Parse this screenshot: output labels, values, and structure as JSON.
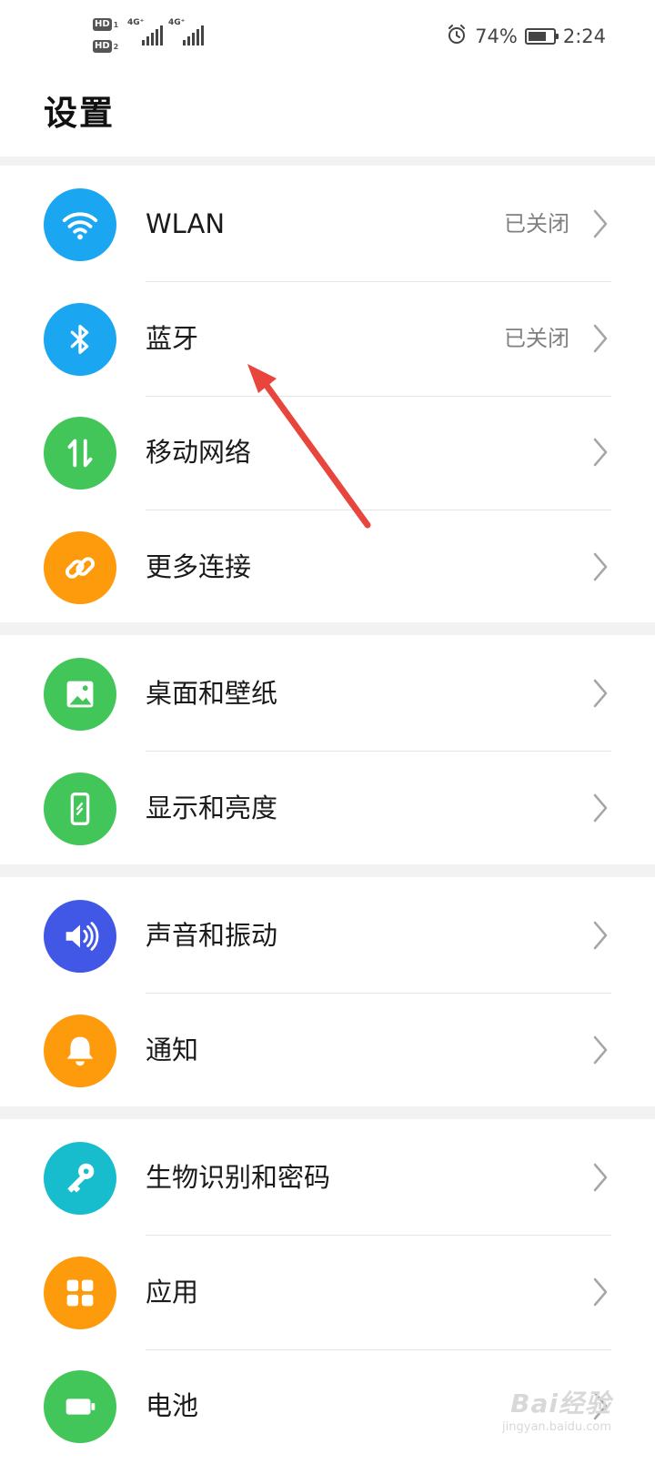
{
  "status_bar": {
    "hd1": "HD",
    "hd1_sim": "1",
    "hd2": "HD",
    "hd2_sim": "2",
    "net1": "4G⁺",
    "net2": "4G⁺",
    "battery_percent": "74%",
    "battery_level": 0.74,
    "time": "2:24",
    "icons": [
      "alarm-icon",
      "battery-icon",
      "signal-icon"
    ]
  },
  "page": {
    "title": "设置"
  },
  "groups": [
    {
      "items": [
        {
          "label": "WLAN",
          "value": "已关闭",
          "icon": "wifi-icon",
          "color": "#1aa6f1"
        },
        {
          "label": "蓝牙",
          "value": "已关闭",
          "icon": "bluetooth-icon",
          "color": "#1aa6f1"
        },
        {
          "label": "移动网络",
          "icon": "mobile-data-icon",
          "color": "#43c659"
        },
        {
          "label": "更多连接",
          "icon": "link-icon",
          "color": "#fd9b0d"
        }
      ]
    },
    {
      "items": [
        {
          "label": "桌面和壁纸",
          "icon": "wallpaper-icon",
          "color": "#43c659"
        },
        {
          "label": "显示和亮度",
          "icon": "display-icon",
          "color": "#43c659"
        }
      ]
    },
    {
      "items": [
        {
          "label": "声音和振动",
          "icon": "sound-icon",
          "color": "#4158e7"
        },
        {
          "label": "通知",
          "icon": "bell-icon",
          "color": "#fd9b0d"
        }
      ]
    },
    {
      "items": [
        {
          "label": "生物识别和密码",
          "icon": "key-icon",
          "color": "#18bdcd"
        },
        {
          "label": "应用",
          "icon": "apps-icon",
          "color": "#fd9b0d"
        },
        {
          "label": "电池",
          "icon": "battery-settings-icon",
          "color": "#43c659"
        }
      ]
    }
  ],
  "annotation": {
    "arrow_color": "#e8453c"
  },
  "watermark": {
    "brand": "Bai经验",
    "sub": "jingyan.baidu.com"
  }
}
